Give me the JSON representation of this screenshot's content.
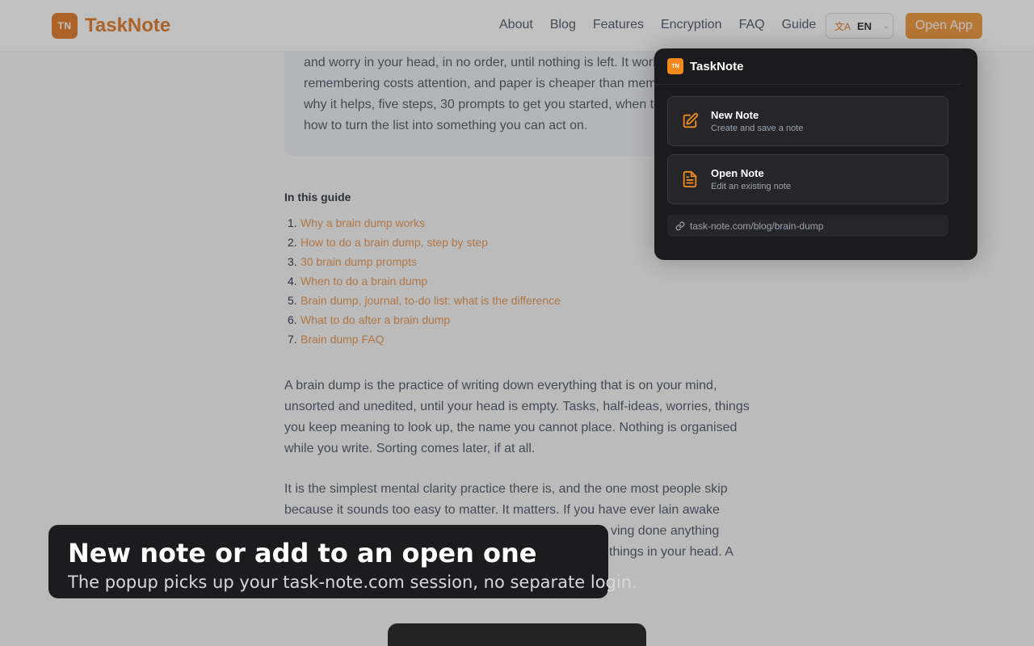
{
  "header": {
    "logo_mark": "TN",
    "logo_text": "TaskNote",
    "nav": [
      "About",
      "Blog",
      "Features",
      "Encryption",
      "FAQ",
      "Guide"
    ],
    "language": "EN",
    "open_app": "Open App"
  },
  "article": {
    "intro_lines": [
      "and worry in your head, in no order, until nothing is left. It works",
      "remembering costs attention, and paper is cheaper than memory.",
      "why it helps, five steps, 30 prompts to get you started, when to",
      "how to turn the list into something you can act on."
    ],
    "toc_title": "In this guide",
    "toc": [
      {
        "n": "1.",
        "label": "Why a brain dump works"
      },
      {
        "n": "2.",
        "label": "How to do a brain dump, step by step"
      },
      {
        "n": "3.",
        "label": "30 brain dump prompts"
      },
      {
        "n": "4.",
        "label": "When to do a brain dump"
      },
      {
        "n": "5.",
        "label": "Brain dump, journal, to-do list: what is the difference"
      },
      {
        "n": "6.",
        "label": "What to do after a brain dump"
      },
      {
        "n": "7.",
        "label": "Brain dump FAQ"
      }
    ],
    "para1": [
      "A brain dump is the practice of writing down everything that is on your mind,",
      "unsorted and unedited, until your head is empty. Tasks, half-ideas, worries, things",
      "you keep meaning to look up, the name you cannot place. Nothing is organised",
      "while you write. Sorting comes later, if at all."
    ],
    "para2": [
      "It is the simplest mental clarity practice there is, and the one most people skip",
      "because it sounds too easy to matter. It matters. If you have ever lain awake",
      "ving done anything",
      "things in your head. A"
    ]
  },
  "popup": {
    "mark": "TN",
    "title": "TaskNote",
    "new_note_title": "New Note",
    "new_note_sub": "Create and save a note",
    "open_note_title": "Open Note",
    "open_note_sub": "Edit an existing note",
    "url": "task-note.com/blog/brain-dump"
  },
  "caption": {
    "title": "New note or add to an open one",
    "subtitle": "The popup picks up your task-note.com session, no separate login."
  },
  "colors": {
    "brand": "#e06a0b",
    "accent": "#f08a1f",
    "link": "#e8893a"
  }
}
